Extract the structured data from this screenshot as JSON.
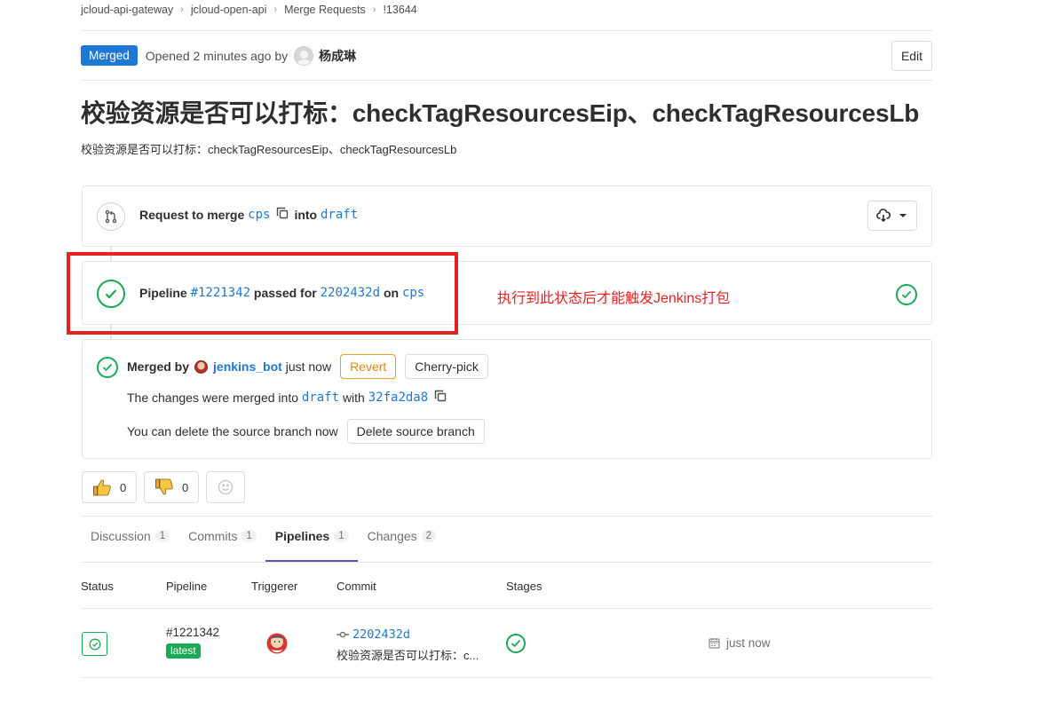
{
  "breadcrumb": {
    "items": [
      "jcloud-api-gateway",
      "jcloud-open-api",
      "Merge Requests",
      "!13644"
    ]
  },
  "header": {
    "status_badge": "Merged",
    "opened_text": "Opened 2 minutes ago by",
    "author": "杨成琳",
    "edit_label": "Edit"
  },
  "title": "校验资源是否可以打标：checkTagResourcesEip、checkTagResourcesLb",
  "description": "校验资源是否可以打标：checkTagResourcesEip、checkTagResourcesLb",
  "merge_request": {
    "label": "Request to merge",
    "source_branch": "cps",
    "into_label": "into",
    "target_branch": "draft"
  },
  "pipeline_widget": {
    "label": "Pipeline",
    "pipeline_id": "#1221342",
    "passed_for": "passed for",
    "commit": "2202432d",
    "on_label": "on",
    "branch": "cps"
  },
  "annotation": "执行到此状态后才能触发Jenkins打包",
  "merged_widget": {
    "merged_by_label": "Merged by",
    "user": "jenkins_bot",
    "time": "just now",
    "revert_label": "Revert",
    "cherry_pick_label": "Cherry-pick",
    "changes_text": "The changes were merged into",
    "target_branch": "draft",
    "with_label": "with",
    "merge_commit": "32fa2da8",
    "delete_text": "You can delete the source branch now",
    "delete_button": "Delete source branch"
  },
  "awards": {
    "thumbs_up_count": "0",
    "thumbs_down_count": "0"
  },
  "tabs": [
    {
      "label": "Discussion",
      "count": "1"
    },
    {
      "label": "Commits",
      "count": "1"
    },
    {
      "label": "Pipelines",
      "count": "1"
    },
    {
      "label": "Changes",
      "count": "2"
    }
  ],
  "table": {
    "headers": [
      "Status",
      "Pipeline",
      "Triggerer",
      "Commit",
      "Stages"
    ],
    "rows": [
      {
        "pipeline_id": "#1221342",
        "badge": "latest",
        "commit_sha": "2202432d",
        "commit_message": "校验资源是否可以打标：c...",
        "time": "just now"
      }
    ]
  },
  "colors": {
    "accent_blue": "#1f78d1",
    "success_green": "#1aaa55",
    "annotation_red": "#e52323",
    "revert_orange": "#e0861e",
    "active_tab": "#6b4fbb"
  }
}
